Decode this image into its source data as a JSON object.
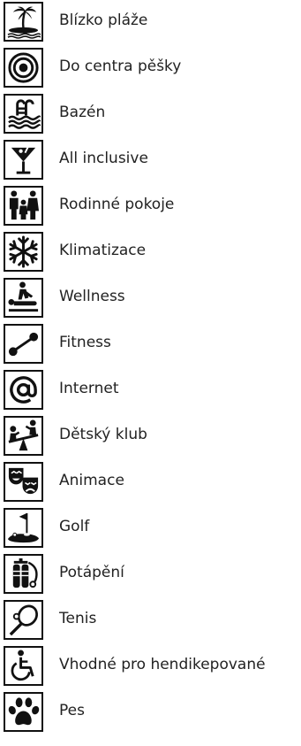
{
  "amenities": [
    {
      "label": "Blízko pláže",
      "icon": "beach-palm-icon"
    },
    {
      "label": "Do centra pěšky",
      "icon": "target-icon"
    },
    {
      "label": "Bazén",
      "icon": "pool-ladder-icon"
    },
    {
      "label": "All inclusive",
      "icon": "cocktail-glass-icon"
    },
    {
      "label": "Rodinné pokoje",
      "icon": "family-icon"
    },
    {
      "label": "Klimatizace",
      "icon": "snowflake-icon"
    },
    {
      "label": "Wellness",
      "icon": "massage-icon"
    },
    {
      "label": "Fitness",
      "icon": "dumbbell-icon"
    },
    {
      "label": "Internet",
      "icon": "at-sign-icon"
    },
    {
      "label": "Dětský klub",
      "icon": "seesaw-children-icon"
    },
    {
      "label": "Animace",
      "icon": "theater-masks-icon"
    },
    {
      "label": "Golf",
      "icon": "golf-flag-icon"
    },
    {
      "label": "Potápění",
      "icon": "diving-tank-icon"
    },
    {
      "label": "Tenis",
      "icon": "tennis-racket-icon"
    },
    {
      "label": "Vhodné pro hendikepované",
      "icon": "wheelchair-icon"
    },
    {
      "label": "Pes",
      "icon": "paw-icon"
    }
  ]
}
